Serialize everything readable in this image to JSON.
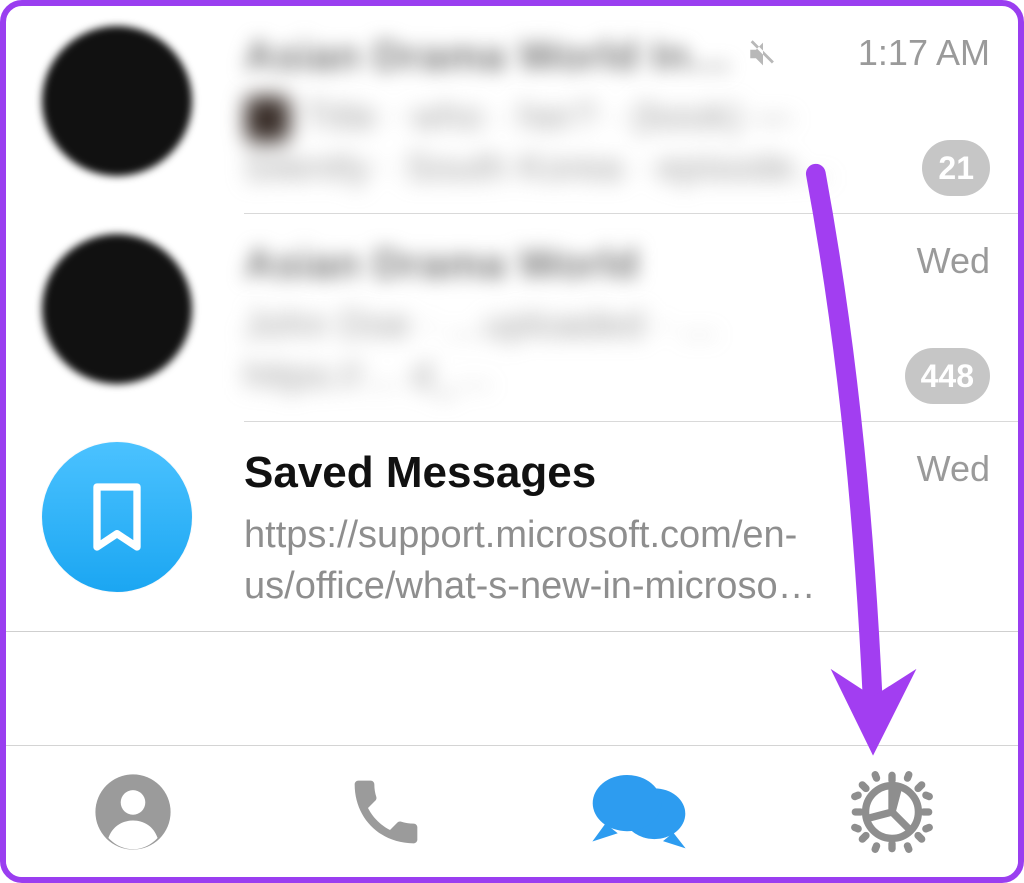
{
  "chats": [
    {
      "title": "Asian Drama World In…",
      "muted": true,
      "timestamp": "1:17 AM",
      "preview": "Title · who · her? · (book) — Silently · South Korea · episode…",
      "badge": "21"
    },
    {
      "title": "Asian Drama World",
      "muted": false,
      "timestamp": "Wed",
      "preview": "John Doe · …uploaded · … https://… d_…",
      "badge": "448"
    },
    {
      "title": "Saved Messages",
      "timestamp": "Wed",
      "preview": "https://support.microsoft.com/en-us/office/what-s-new-in-microso…"
    }
  ],
  "tabs": {
    "contacts": "Contacts",
    "calls": "Calls",
    "chats": "Chats",
    "settings": "Settings"
  }
}
